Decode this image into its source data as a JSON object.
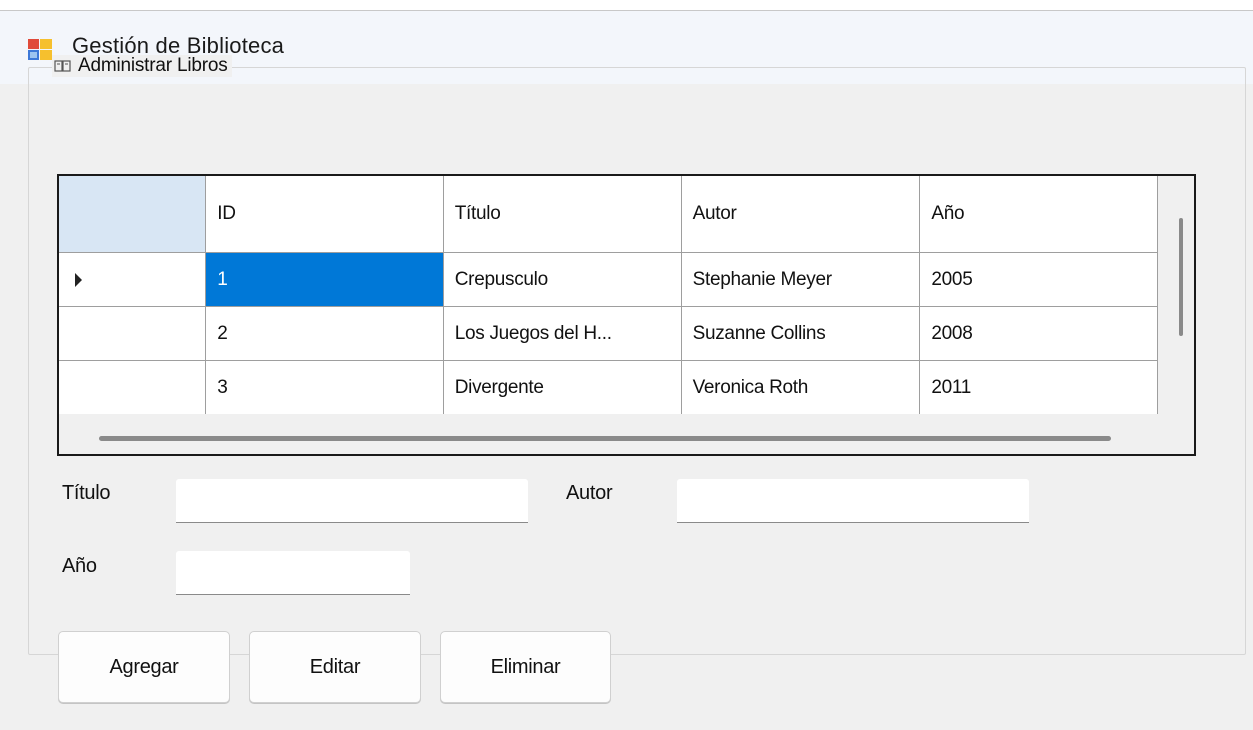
{
  "window": {
    "title": "Gestión de Biblioteca",
    "icon": "windows-forms-app-icon"
  },
  "groupbox": {
    "label": "Administrar Libros",
    "icon": "books-icon"
  },
  "grid": {
    "columns": [
      "ID",
      "Título",
      "Autor",
      "Año"
    ],
    "rows": [
      {
        "id": "1",
        "titulo": "Crepusculo",
        "autor": "Stephanie Meyer",
        "anio": "2005"
      },
      {
        "id": "2",
        "titulo": "Los Juegos del H...",
        "autor": "Suzanne Collins",
        "anio": "2008"
      },
      {
        "id": "3",
        "titulo": "Divergente",
        "autor": "Veronica Roth",
        "anio": "2011"
      }
    ],
    "selected_row": 0,
    "selected_color": "#0078d7",
    "corner_color": "#d8e6f4"
  },
  "form": {
    "titulo_label": "Título",
    "titulo_value": "",
    "autor_label": "Autor",
    "autor_value": "",
    "anio_label": "Año",
    "anio_value": ""
  },
  "buttons": {
    "agregar": "Agregar",
    "editar": "Editar",
    "eliminar": "Eliminar"
  }
}
